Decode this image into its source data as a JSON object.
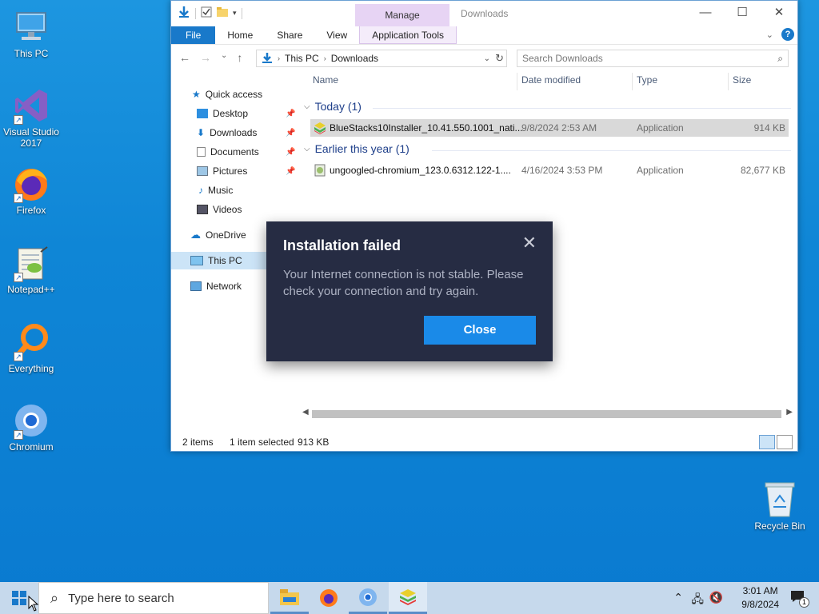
{
  "desktop": {
    "icons": [
      {
        "label": "This PC",
        "icon": "computer-icon"
      },
      {
        "label": "Visual Studio 2017",
        "icon": "visual-studio-icon"
      },
      {
        "label": "Firefox",
        "icon": "firefox-icon"
      },
      {
        "label": "Notepad++",
        "icon": "notepadpp-icon"
      },
      {
        "label": "Everything",
        "icon": "everything-icon"
      },
      {
        "label": "Chromium",
        "icon": "chromium-icon"
      }
    ],
    "recycle_bin": "Recycle Bin"
  },
  "explorer": {
    "manage_label": "Manage",
    "window_title": "Downloads",
    "tabs": [
      "File",
      "Home",
      "Share",
      "View",
      "Application Tools"
    ],
    "address": {
      "segments": [
        "This PC",
        "Downloads"
      ]
    },
    "search_placeholder": "Search Downloads",
    "nav": [
      {
        "label": "Quick access"
      },
      {
        "label": "Desktop"
      },
      {
        "label": "Downloads"
      },
      {
        "label": "Documents"
      },
      {
        "label": "Pictures"
      },
      {
        "label": "Music"
      },
      {
        "label": "Videos"
      },
      {
        "label": "OneDrive"
      },
      {
        "label": "This PC"
      },
      {
        "label": "Network"
      }
    ],
    "columns": [
      "Name",
      "Date modified",
      "Type",
      "Size"
    ],
    "groups": [
      {
        "label": "Today (1)",
        "files": [
          {
            "name": "BlueStacks10Installer_10.41.550.1001_nati...",
            "date": "9/8/2024 2:53 AM",
            "type": "Application",
            "size": "914 KB"
          }
        ]
      },
      {
        "label": "Earlier this year (1)",
        "files": [
          {
            "name": "ungoogled-chromium_123.0.6312.122-1....",
            "date": "4/16/2024 3:53 PM",
            "type": "Application",
            "size": "82,677 KB"
          }
        ]
      }
    ],
    "status": {
      "items": "2 items",
      "selected": "1 item selected",
      "size": "913 KB"
    }
  },
  "dialog": {
    "title": "Installation failed",
    "message": "Your Internet connection is not stable. Please check your connection and try again.",
    "button": "Close"
  },
  "taskbar": {
    "search_placeholder": "Type here to search",
    "time": "3:01 AM",
    "date": "9/8/2024",
    "notification_count": "1"
  },
  "colors": {
    "accent": "#1979ca",
    "dialog_bg": "#262c43",
    "dialog_button": "#1a8ae8",
    "manage_tab": "#e7d4f4"
  }
}
